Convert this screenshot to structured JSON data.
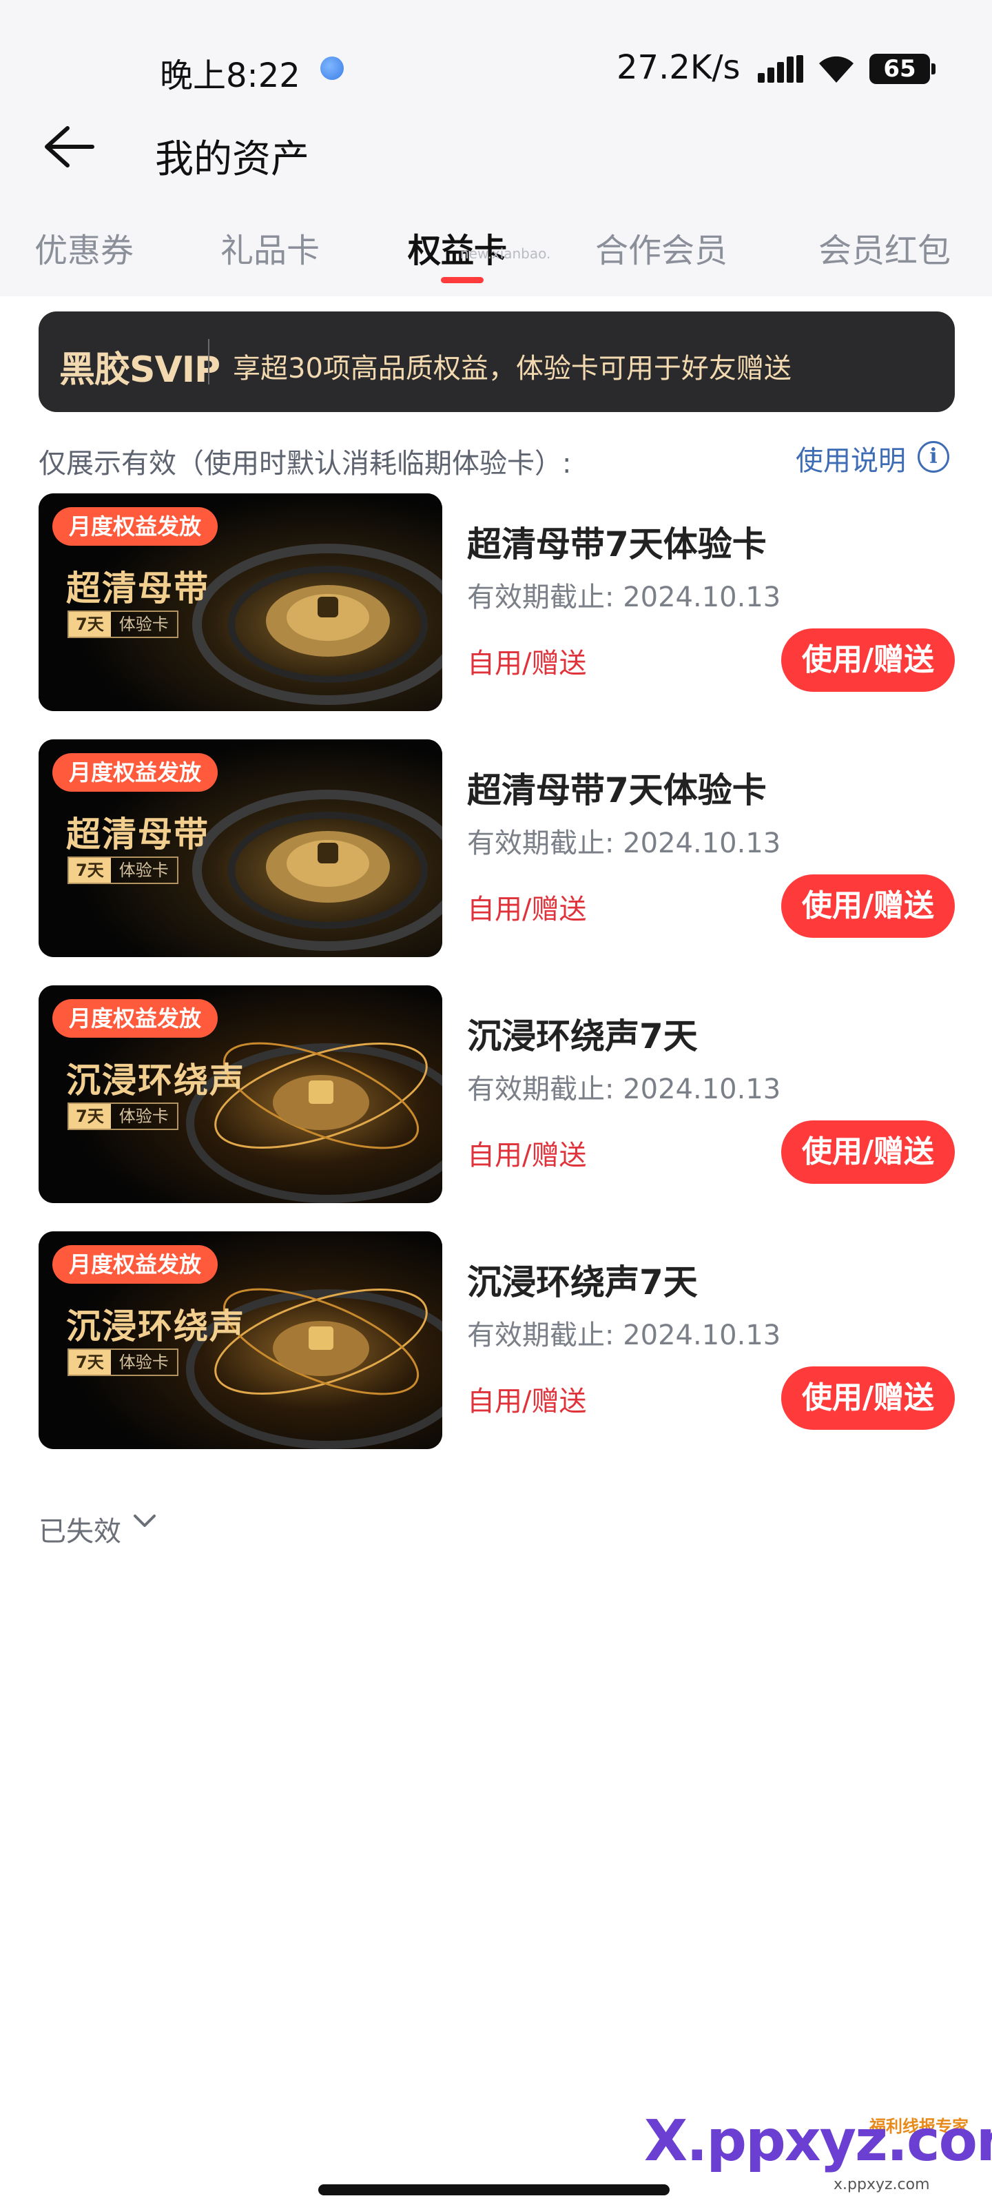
{
  "status_bar": {
    "time": "晚上8:22",
    "net_speed": "27.2K/s",
    "battery": "65"
  },
  "header": {
    "title": "我的资产"
  },
  "tabs": [
    {
      "label": "优惠券"
    },
    {
      "label": "礼品卡"
    },
    {
      "label": "权益卡"
    },
    {
      "label": "合作会员"
    },
    {
      "label": "会员红包"
    }
  ],
  "tab_watermark": "new.xianbao.",
  "banner": {
    "brand": "黑胶SVIP",
    "text": "享超30项高品质权益，体验卡可用于好友赠送"
  },
  "info": {
    "text": "仅展示有效（使用时默认消耗临期体验卡）:",
    "help": "使用说明"
  },
  "cards": [
    {
      "tag": "月度权益发放",
      "thumb_name": "超清母带",
      "days": "7天",
      "kind": "体验卡",
      "title": "超清母带7天体验卡",
      "expiry": "有效期截止: 2024.10.13",
      "usage": "自用/赠送",
      "button": "使用/赠送"
    },
    {
      "tag": "月度权益发放",
      "thumb_name": "超清母带",
      "days": "7天",
      "kind": "体验卡",
      "title": "超清母带7天体验卡",
      "expiry": "有效期截止: 2024.10.13",
      "usage": "自用/赠送",
      "button": "使用/赠送"
    },
    {
      "tag": "月度权益发放",
      "thumb_name": "沉浸环绕声",
      "days": "7天",
      "kind": "体验卡",
      "title": "沉浸环绕声7天",
      "expiry": "有效期截止: 2024.10.13",
      "usage": "自用/赠送",
      "button": "使用/赠送"
    },
    {
      "tag": "月度权益发放",
      "thumb_name": "沉浸环绕声",
      "days": "7天",
      "kind": "体验卡",
      "title": "沉浸环绕声7天",
      "expiry": "有效期截止: 2024.10.13",
      "usage": "自用/赠送",
      "button": "使用/赠送"
    }
  ],
  "expired_label": "已失效",
  "footer_watermark": {
    "main": "X.ppxyz.com",
    "sub": "x.ppxyz.com",
    "tag": "福利线报专家"
  },
  "colors": {
    "accent": "#ff3a3a",
    "link": "#3f6db5",
    "gold": "#f2cf8f",
    "banner_bg": "#2a2a2c"
  }
}
